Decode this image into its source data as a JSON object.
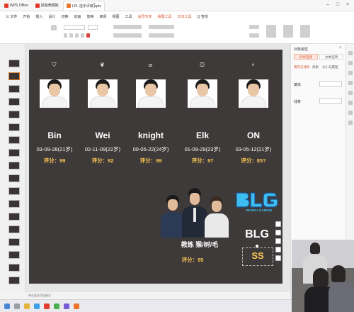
{
  "window": {
    "tabs": [
      {
        "label": "WPS Office",
        "color": "#e23b2e"
      },
      {
        "label": "找稻壳模板",
        "color": "#e23b2e"
      },
      {
        "label": "LPL 选手评级.pptx",
        "color": "#e8742a"
      }
    ]
  },
  "menu": {
    "items": [
      "三 文件",
      "开始",
      "插入",
      "设计",
      "切换",
      "动画",
      "放映",
      "审阅",
      "视图",
      "工具",
      "会员专享",
      "绘图工具",
      "文本工具",
      "Q 查找"
    ]
  },
  "slide": {
    "players": [
      {
        "role_icon": "top-lane-icon",
        "name": "Bin",
        "birth": "03-09-28(21岁)",
        "score": "评分：99"
      },
      {
        "role_icon": "jungle-icon",
        "name": "Wei",
        "birth": "02-11-09(22岁)",
        "score": "评分：92"
      },
      {
        "role_icon": "mid-lane-icon",
        "name": "knight",
        "birth": "00-05-22(24岁)",
        "score": "评分：99"
      },
      {
        "role_icon": "bot-lane-icon",
        "name": "Elk",
        "birth": "01-09-29(23岁)",
        "score": "评分：97"
      },
      {
        "role_icon": "support-icon",
        "name": "ON",
        "birth": "03-05-12(21岁)",
        "score": "评分：85?"
      }
    ],
    "coach_label": "教练 猴/树/毛",
    "coach_score": "评分：95",
    "team_logo_text": "BLG",
    "team_logo_sub": "BILIBILI GAMING",
    "team_name": "BLG",
    "team_rating": "SS",
    "team_rating_color": "#f6c453",
    "logo_color": "#3dbdf2"
  },
  "right_panel": {
    "title": "对象属性",
    "tabs": [
      "形状选项",
      "文本选项"
    ],
    "subtabs": [
      "填充与线条",
      "效果",
      "大小与属性"
    ],
    "fill_label": "填充",
    "line_label": "线条"
  },
  "status": {
    "text": "单击此处添加备注"
  }
}
